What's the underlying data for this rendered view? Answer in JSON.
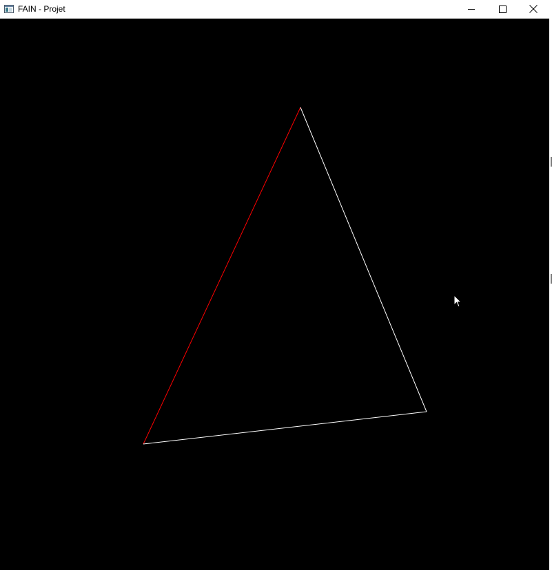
{
  "window": {
    "title": "FAIN - Projet",
    "minimize_icon": "minimize-icon",
    "maximize_icon": "maximize-icon",
    "close_icon": "close-icon",
    "app_icon": "app-window-icon"
  },
  "scene": {
    "background_color": "#000000",
    "triangle": {
      "edge_colors": {
        "left_edge": "#ff0000",
        "right_edge": "#ffffff",
        "bottom_edge": "#ffffff"
      }
    },
    "cursor_icon": "mouse-pointer-icon"
  }
}
